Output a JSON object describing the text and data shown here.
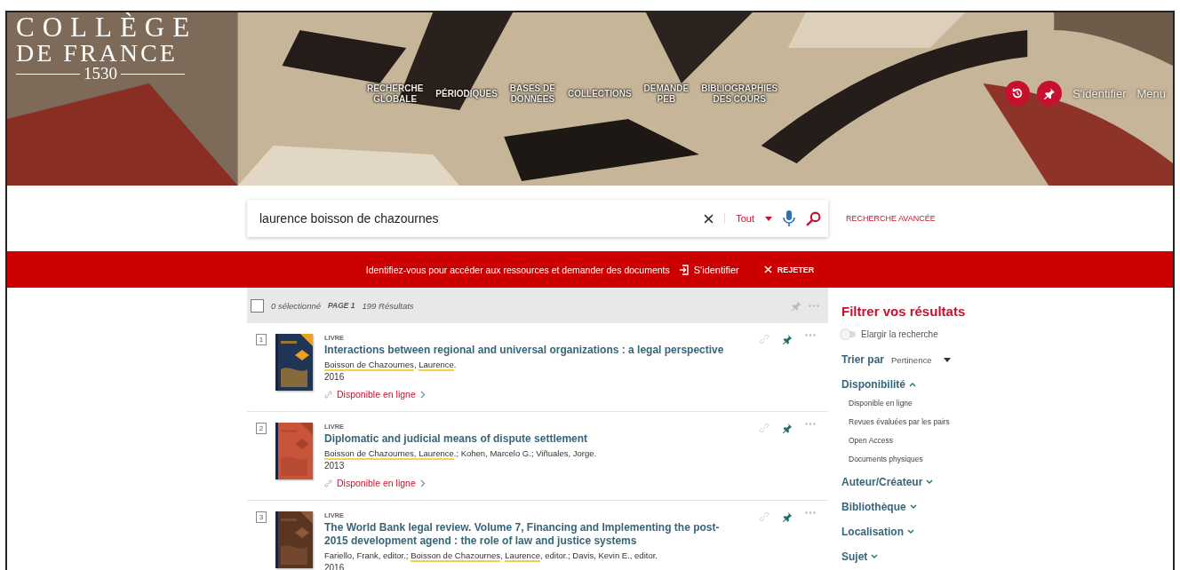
{
  "header": {
    "logo": {
      "line1": "COLLÈGE",
      "line2": "DE FRANCE",
      "year": "1530"
    },
    "nav": [
      "RECHERCHE\nGLOBALE",
      "PÉRIODIQUES",
      "BASES DE\nDONNÉES",
      "COLLECTIONS",
      "DEMANDE\nPEB",
      "BIBLIOGRAPHIES\nDES COURS"
    ],
    "signin": "S'identifier",
    "menu": "Menu"
  },
  "search": {
    "value": "laurence boisson de chazournes",
    "scope": "Tout",
    "advanced": "RECHERCHE AVANCÉE"
  },
  "banner": {
    "message": "Identifiez-vous pour accéder aux ressources et demander des documents",
    "signin": "S'identifier",
    "dismiss": "REJETER"
  },
  "toolbar": {
    "checked": false,
    "selected_count": "0 sélectionné",
    "page": "PAGE 1",
    "results": "199 Résultats"
  },
  "results": [
    {
      "number": "1",
      "type": "LIVRE",
      "title": "Interactions between regional and universal organizations : a legal perspective",
      "authors": [
        {
          "text": "Boisson de Chazournes",
          "highlight": true
        },
        {
          "text": ", ",
          "highlight": false
        },
        {
          "text": "Laurence",
          "highlight": true
        },
        {
          "text": ".",
          "highlight": false
        }
      ],
      "year": "2016",
      "availability": "Disponible en ligne",
      "pinned": true
    },
    {
      "number": "2",
      "type": "LIVRE",
      "title": "Diplomatic and judicial means of dispute settlement",
      "authors": [
        {
          "text": "Boisson de Chazournes, Laurence",
          "highlight": true
        },
        {
          "text": ".; Kohen, Marcelo G.; Viñuales, Jorge.",
          "highlight": false
        }
      ],
      "year": "2013",
      "availability": "Disponible en ligne",
      "pinned": true
    },
    {
      "number": "3",
      "type": "LIVRE",
      "title": "The World Bank legal review. Volume 7, Financing and Implementing the post-2015 development agend : the role of law and justice systems",
      "authors": [
        {
          "text": "Fariello, Frank, editor.; ",
          "highlight": false
        },
        {
          "text": "Boisson de Chazournes",
          "highlight": true
        },
        {
          "text": ", ",
          "highlight": false
        },
        {
          "text": "Laurence",
          "highlight": true
        },
        {
          "text": ", editor.; Davis, Kevin E., editor.",
          "highlight": false
        }
      ],
      "year": "2016",
      "pinned": true
    }
  ],
  "filters": {
    "title": "Filtrer vos résultats",
    "expand": {
      "label": "Elargir la recherche",
      "on": false
    },
    "sort": {
      "label": "Trier par",
      "value": "Pertinence"
    },
    "facets": [
      {
        "label": "Disponibilité",
        "expanded": true,
        "options": [
          "Disponible en ligne",
          "Revues évaluées par les pairs",
          "Open Access",
          "Documents physiques"
        ]
      },
      {
        "label": "Auteur/Créateur",
        "expanded": false
      },
      {
        "label": "Bibliothèque",
        "expanded": false
      },
      {
        "label": "Localisation",
        "expanded": false
      },
      {
        "label": "Sujet",
        "expanded": false
      }
    ]
  }
}
